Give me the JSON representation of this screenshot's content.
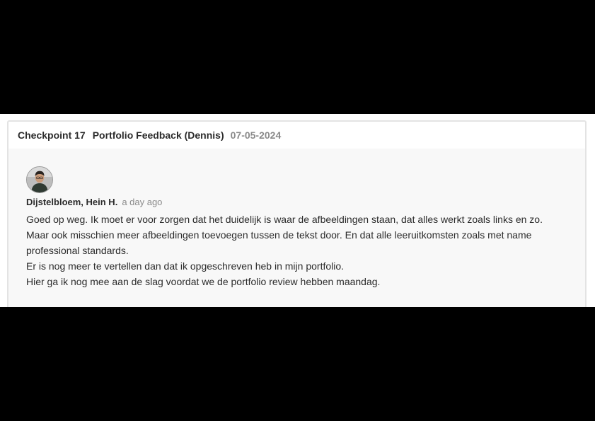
{
  "card": {
    "checkpoint": "Checkpoint 17",
    "title": "Portfolio Feedback (Dennis)",
    "date": "07-05-2024"
  },
  "comment": {
    "author": "Dijstelbloem, Hein H.",
    "time_ago": "a day ago",
    "lines": [
      "Goed op weg. Ik moet er voor zorgen dat het duidelijk is waar de afbeeldingen staan, dat alles werkt zoals links en zo.",
      "Maar ook misschien meer afbeeldingen toevoegen tussen de tekst door. En dat alle leeruitkomsten zoals met name",
      "professional standards.",
      "Er is nog meer te vertellen dan dat ik opgeschreven heb in mijn portfolio.",
      "Hier ga ik nog mee aan de slag voordat we de portfolio review hebben maandag."
    ]
  },
  "colors": {
    "text": "#2b2b2b",
    "muted": "#8a8a8a",
    "body_bg": "#f8f8f8",
    "border": "#e3e3e3"
  }
}
